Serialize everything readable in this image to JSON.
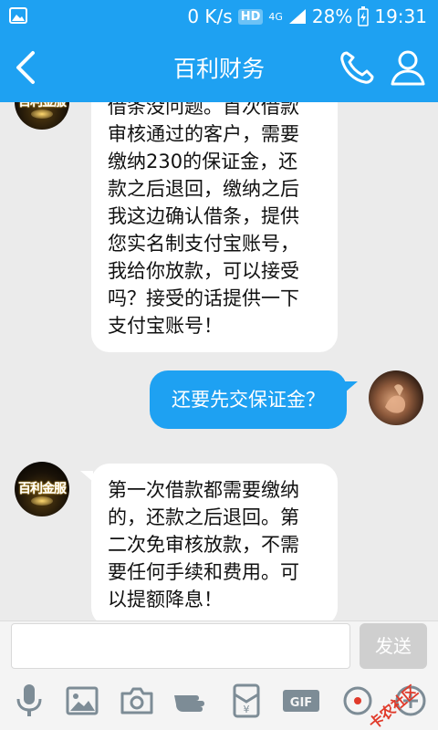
{
  "status_bar": {
    "speed": "0 K/s",
    "hd": "HD",
    "network": "4G",
    "battery": "28%",
    "time": "19:31"
  },
  "header": {
    "title": "百利财务"
  },
  "messages": [
    {
      "side": "in",
      "avatar": "logo",
      "lines": [
        "借条没问题。首次借款",
        "审核通过的客户，需要",
        "缴纳230的保证金，还",
        "款之后退回，缴纳之后",
        "我这边确认借条，提供",
        "您实名制支付宝账号，",
        "我给你放款，可以接受",
        "吗？接受的话提供一下",
        "支付宝账号！"
      ]
    },
    {
      "side": "out",
      "avatar": "photo",
      "lines": [
        "还要先交保证金？"
      ]
    },
    {
      "side": "in",
      "avatar": "logo",
      "lines": [
        "第一次借款都需要缴纳",
        "的，还款之后退回。第",
        "二次免审核放款，不需",
        "要任何手续和费用。可",
        "以提额降息！"
      ]
    }
  ],
  "avatar_logo_text": "百利金服",
  "input": {
    "placeholder": "",
    "send_label": "发送"
  },
  "toolbar": [
    "microphone-icon",
    "image-icon",
    "camera-icon",
    "poke-icon",
    "red-packet-icon",
    "gif-icon",
    "more-icon",
    "add-icon"
  ],
  "watermark": "卡农社区",
  "colors": {
    "accent": "#1ea1f2",
    "background": "#ebebeb"
  }
}
